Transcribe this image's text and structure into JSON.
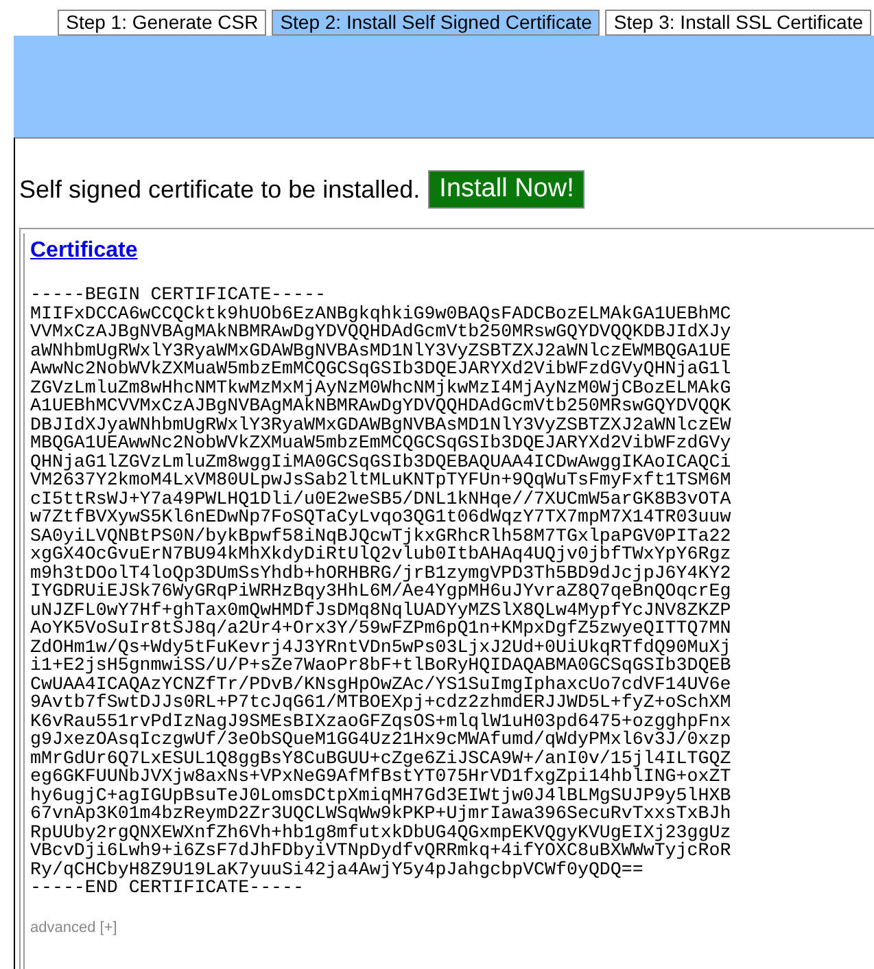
{
  "tabs": [
    {
      "label": "Step 1: Generate CSR",
      "selected": false
    },
    {
      "label": "Step 2: Install Self Signed Certificate",
      "selected": true
    },
    {
      "label": "Step 3: Install SSL Certificate",
      "selected": false
    }
  ],
  "message": "Self signed certificate to be installed.",
  "install_button": "Install Now!",
  "certificate": {
    "title": "Certificate",
    "lines": [
      "-----BEGIN CERTIFICATE-----",
      "MIIFxDCCA6wCCQCktk9hUOb6EzANBgkqhkiG9w0BAQsFADCBozELMAkGA1UEBhMC",
      "VVMxCzAJBgNVBAgMAkNBMRAwDgYDVQQHDAdGcmVtb250MRswGQYDVQQKDBJIdXJy",
      "aWNhbmUgRWxlY3RyaWMxGDAWBgNVBAsMD1NlY3VyZSBTZXJ2aWNlczEWMBQGA1UE",
      "AwwNc2NobWVkZXMuaW5mbzEmMCQGCSqGSIb3DQEJARYXd2VibWFzdGVyQHNjaG1l",
      "ZGVzLmluZm8wHhcNMTkwMzMxMjAyNzM0WhcNMjkwMzI4MjAyNzM0WjCBozELMAkG",
      "A1UEBhMCVVMxCzAJBgNVBAgMAkNBMRAwDgYDVQQHDAdGcmVtb250MRswGQYDVQQK",
      "DBJIdXJyaWNhbmUgRWxlY3RyaWMxGDAWBgNVBAsMD1NlY3VyZSBTZXJ2aWNlczEW",
      "MBQGA1UEAwwNc2NobWVkZXMuaW5mbzEmMCQGCSqGSIb3DQEJARYXd2VibWFzdGVy",
      "QHNjaG1lZGVzLmluZm8wggIiMA0GCSqGSIb3DQEBAQUAA4ICDwAwggIKAoICAQCi",
      "VM2637Y2kmoM4LxVM80ULpwJsSab2ltMLuKNTpTYFUn+9QqWuTsFmyFxft1TSM6M",
      "cI5ttRsWJ+Y7a49PWLHQ1Dli/u0E2weSB5/DNL1kNHqe//7XUCmW5arGK8B3vOTA",
      "w7ZtfBVXywS5Kl6nEDwNp7FoSQTaCyLvqo3QG1t06dWqzY7TX7mpM7X14TR03uuw",
      "SA0yiLVQNBtPS0N/bykBpwf58iNqBJQcwTjkxGRhcRlh58M7TGxlpaPGV0PITa22",
      "xgGX4OcGvuErN7BU94kMhXkdyDiRtUlQ2vlub0ItbAHAq4UQjv0jbfTWxYpY6Rgz",
      "m9h3tDOolT4loQp3DUmSsYhdb+hORHBRG/jrB1zymgVPD3Th5BD9dJcjpJ6Y4KY2",
      "IYGDRUiEJSk76WyGRqPiWRHzBqy3HhL6M/Ae4YgpMH6uJYvraZ8Q7qeBnQOqcrEg",
      "uNJZFL0wY7Hf+ghTax0mQwHMDfJsDMq8NqlUADYyMZSlX8QLw4MypfYcJNV8ZKZP",
      "AoYK5VoSuIr8tSJ8q/a2Ur4+Orx3Y/59wFZPm6pQ1n+KMpxDgfZ5zwyeQITTQ7MN",
      "ZdOHm1w/Qs+Wdy5tFuKevrj4J3YRntVDn5wPs03LjxJ2Ud+0UiUkqRTfdQ90MuXj",
      "i1+E2jsH5gnmwiSS/U/P+sZe7WaoPr8bF+tlBoRyHQIDAQABMA0GCSqGSIb3DQEB",
      "CwUAA4ICAQAzYCNZfTr/PDvB/KNsgHpOwZAc/YS1SuImgIphaxcUo7cdVF14UV6e",
      "9Avtb7fSwtDJJs0RL+P7tcJqG61/MTBOEXpj+cdz2zhmdERJJWD5L+fyZ+oSchXM",
      "K6vRau551rvPdIzNagJ9SMEsBIXzaoGFZqsOS+mlqlW1uH03pd6475+ozgghpFnx",
      "g9JxezOAsqIczgwUf/3eObSQueM1GG4Uz21Hx9cMWAfumd/qWdyPMxl6v3J/0xzp",
      "mMrGdUr6Q7LxESUL1Q8ggBsY8CuBGUU+cZge6ZiJSCA9W+/anI0v/15jl4ILTGQZ",
      "eg6GKFUUNbJVXjw8axNs+VPxNeG9AfMfBstYT075HrVD1fxgZpi14hblING+oxZT",
      "hy6ugjC+agIGUpBsuTeJ0LomsDCtpXmiqMH7Gd3EIWtjw0J4lBLMgSUJP9y5lHXB",
      "67vnAp3K01m4bzReymD2Zr3UQCLWSqWw9kPKP+UjmrIawa396SecuRvTxxsTxBJh",
      "RpUUby2rgQNXEWXnfZh6Vh+hb1g8mfutxkDbUG4QGxmpEKVQgyKVUgEIXj23ggUz",
      "VBcvDji6Lwh9+i6ZsF7dJhFDbyiVTNpDydfvQRRmkq+4ifYOXC8uBXWWwTyjcRoR",
      "Ry/qCHCbyH8Z9U19LaK7yuuSi42ja4AwjY5y4pJahgcbpVCWf0yQDQ==",
      "-----END CERTIFICATE-----"
    ]
  },
  "advanced_link": "advanced [+]"
}
